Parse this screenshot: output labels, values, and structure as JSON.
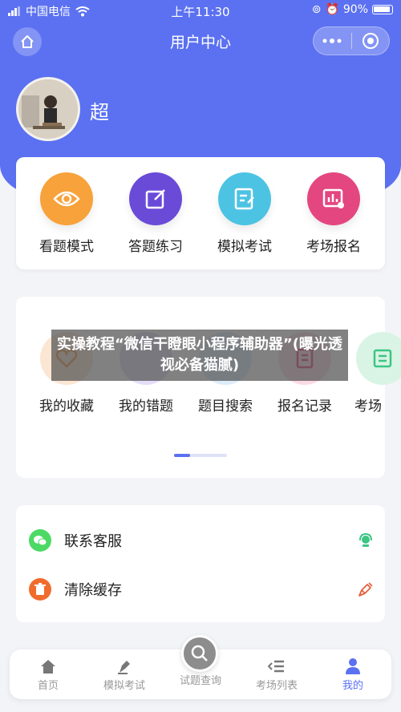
{
  "status_bar": {
    "carrier": "中国电信",
    "time": "上午11:30",
    "battery": "90%"
  },
  "nav": {
    "title": "用户中心",
    "home_icon": "home-icon",
    "more_icon": "more-dots-icon",
    "close_icon": "target-icon"
  },
  "profile": {
    "name": "超"
  },
  "quick_actions": [
    {
      "label": "看题模式",
      "icon": "eye-icon",
      "color": "#f7a23b"
    },
    {
      "label": "答题练习",
      "icon": "edit-icon",
      "color": "#6a4bd8"
    },
    {
      "label": "模拟考试",
      "icon": "document-edit-icon",
      "color": "#4cc3e3"
    },
    {
      "label": "考场报名",
      "icon": "chart-icon",
      "color": "#e4467f"
    }
  ],
  "tools": [
    {
      "label": "我的收藏",
      "icon": "heart-icon",
      "color": "#fbe6d3"
    },
    {
      "label": "我的错题",
      "icon": "error-book-icon",
      "color": "#e5def8"
    },
    {
      "label": "题目搜索",
      "icon": "search-icon",
      "color": "#dcecf9"
    },
    {
      "label": "报名记录",
      "icon": "receipt-icon",
      "color": "#fadbe5"
    },
    {
      "label": "考场",
      "icon": "list-icon",
      "color": "#d9f4e5"
    }
  ],
  "tools_scroll": {
    "position": 0.0
  },
  "settings": [
    {
      "label": "联系客服",
      "icon": "wechat-icon",
      "color": "#4cd964",
      "right_icon": "customer-service-icon"
    },
    {
      "label": "清除缓存",
      "icon": "trash-icon",
      "color": "#f06c2d",
      "right_icon": "broom-icon"
    }
  ],
  "overlay": {
    "text": "实操教程“微信干瞪眼小程序辅助器”(曝光透视必备猫腻)"
  },
  "tabbar": {
    "items": [
      {
        "label": "首页",
        "icon": "home-icon"
      },
      {
        "label": "模拟考试",
        "icon": "pen-icon"
      },
      {
        "label": "试题查询",
        "icon": "search-icon"
      },
      {
        "label": "考场列表",
        "icon": "list-icon"
      },
      {
        "label": "我的",
        "icon": "user-icon"
      }
    ],
    "active": 4
  },
  "colors": {
    "primary": "#5b71f1"
  }
}
